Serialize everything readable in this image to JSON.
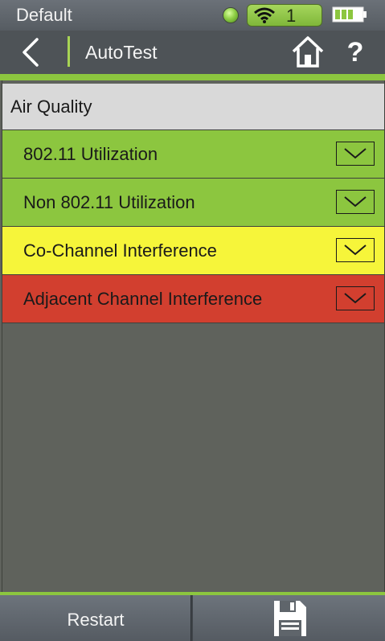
{
  "status_bar": {
    "profile_name": "Default",
    "wifi_count": "1",
    "icons": [
      "status-led-icon",
      "wifi-icon",
      "battery-icon"
    ]
  },
  "title_bar": {
    "title": "AutoTest",
    "icons": [
      "back-arrow-icon",
      "home-icon",
      "help-icon"
    ],
    "help_glyph": "?"
  },
  "section": {
    "title": "Air Quality"
  },
  "rows": [
    {
      "label": "802.11 Utilization",
      "status_color": "#8cc63f"
    },
    {
      "label": "Non 802.11 Utilization",
      "status_color": "#8cc63f"
    },
    {
      "label": "Co-Channel Interference",
      "status_color": "#f6f53a"
    },
    {
      "label": "Adjacent Channel Interference",
      "status_color": "#d23f2f"
    }
  ],
  "bottom_bar": {
    "restart_label": "Restart",
    "save_icon": "save-icon"
  },
  "colors": {
    "accent": "#8cc63f",
    "background": "#5f625c",
    "status_good": "#8cc63f",
    "status_warning": "#f6f53a",
    "status_bad": "#d23f2f"
  }
}
